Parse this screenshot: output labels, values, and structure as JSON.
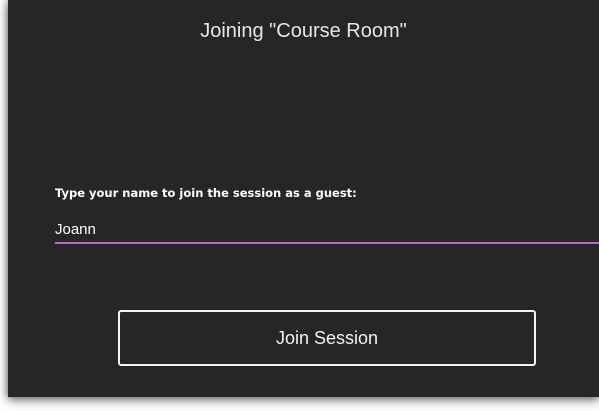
{
  "dialog": {
    "title": "Joining \"Course Room\"",
    "prompt": "Type your name to join the session as a guest:",
    "name_input": {
      "value": "Joann",
      "placeholder": ""
    },
    "join_button_label": "Join Session"
  },
  "colors": {
    "background": "#262626",
    "text": "#ffffff",
    "input_underline": "#b46ad6",
    "button_border": "#f2f2f2"
  }
}
